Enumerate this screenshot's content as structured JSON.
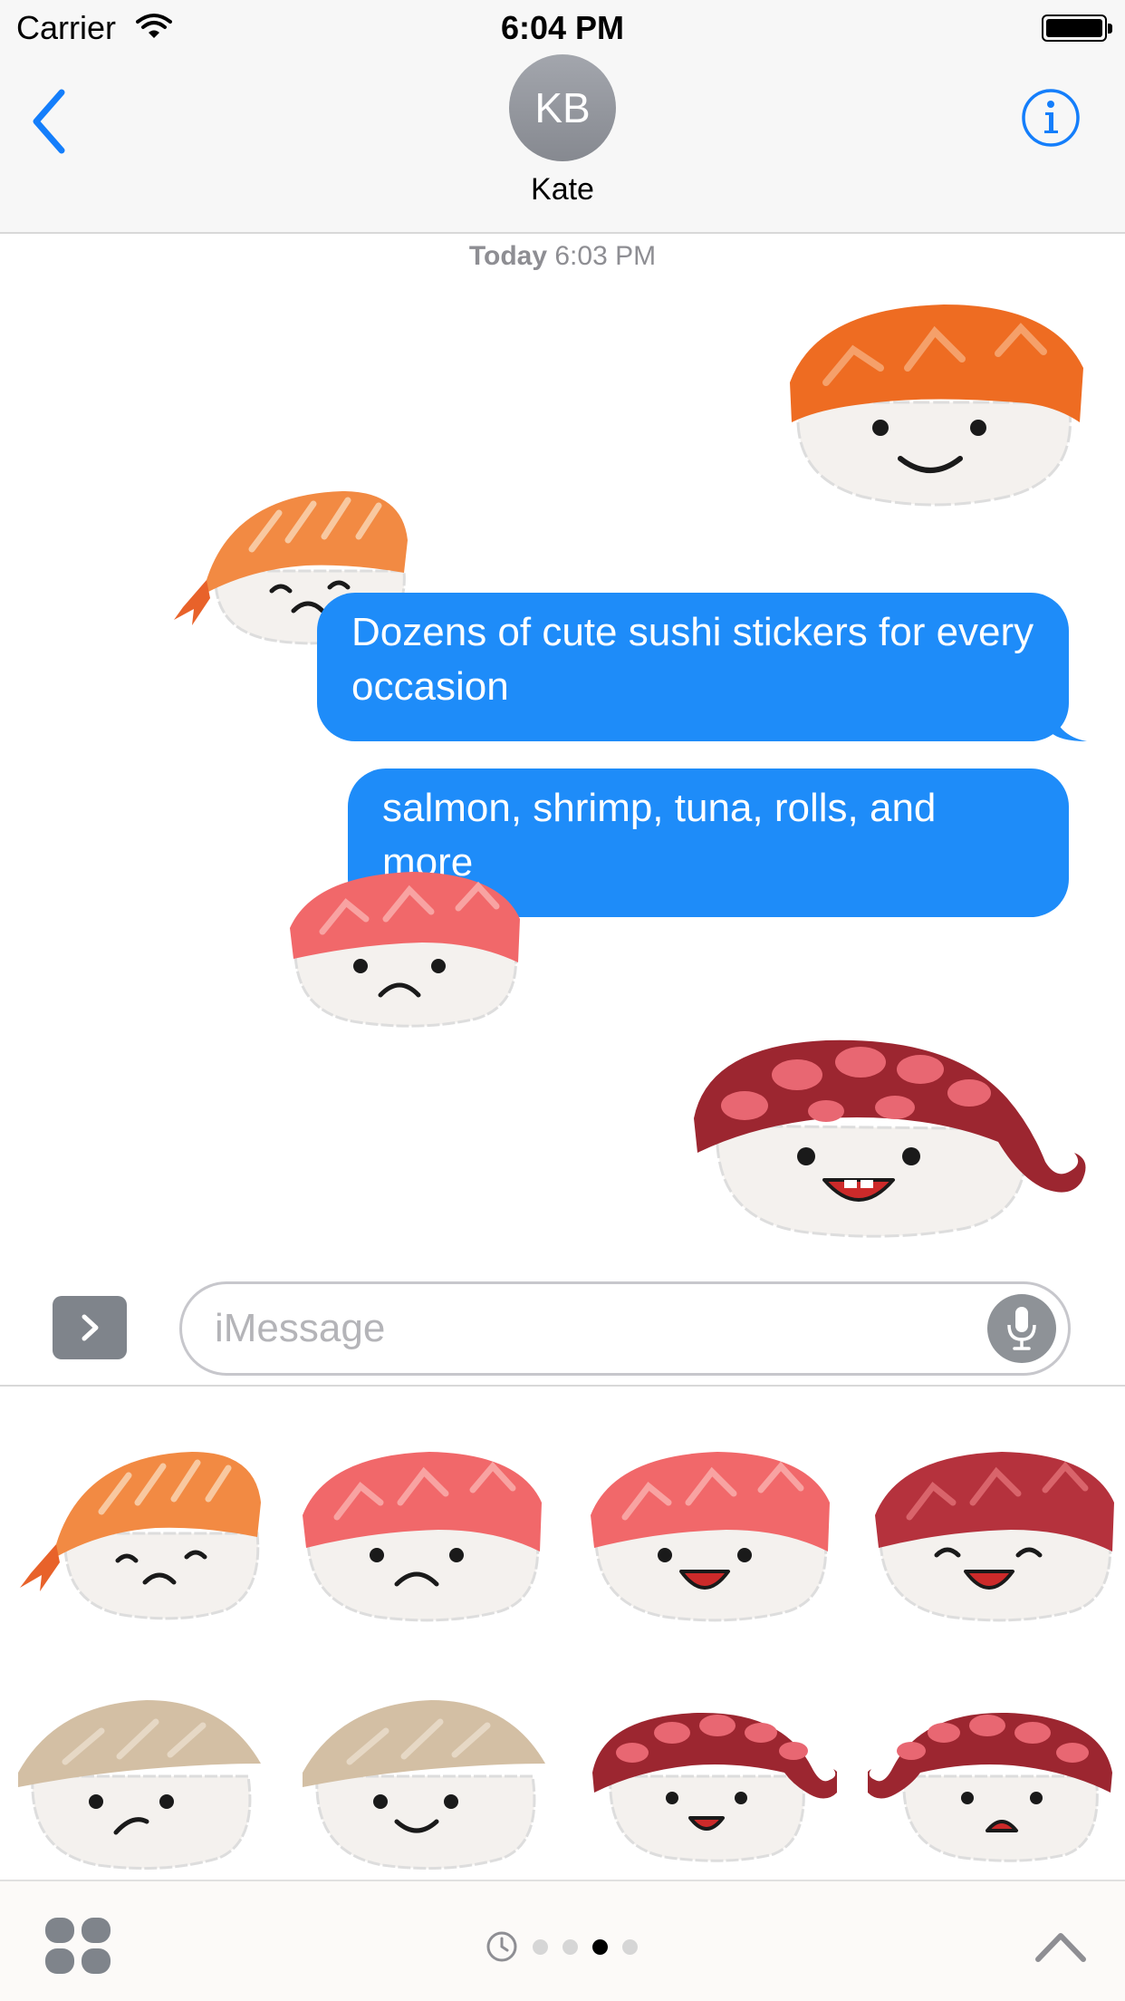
{
  "status_bar": {
    "carrier": "Carrier",
    "time": "6:04 PM"
  },
  "header": {
    "avatar_initials": "KB",
    "contact_name": "Kate",
    "back_icon": "chevron-left-icon",
    "info_icon": "info-icon"
  },
  "conversation": {
    "timestamp_day": "Today",
    "timestamp_time": "6:03 PM",
    "messages": [
      {
        "text": "Dozens of cute sushi stickers for every occasion",
        "sender": "me"
      },
      {
        "text": "salmon, shrimp, tuna, rolls, and more",
        "sender": "me"
      }
    ],
    "stickers": [
      "salmon-happy",
      "shrimp-sad",
      "tuna-sad",
      "octopus-happy"
    ]
  },
  "compose": {
    "placeholder": "iMessage",
    "apps_icon": "chevron-right-icon",
    "mic_icon": "microphone-icon"
  },
  "drawer": {
    "stickers": [
      "shrimp-grumpy",
      "tuna-sad",
      "tuna-laughing",
      "maguro-laughing",
      "hamachi-frown",
      "hamachi-smile",
      "octopus-smile",
      "octopus-worried"
    ],
    "page_count": 4,
    "active_page": 3
  },
  "colors": {
    "bubble_blue": "#1e8cf9",
    "ios_blue": "#147efb",
    "salmon": "#ee6c22",
    "shrimp": "#f28a43",
    "tuna": "#f1686a",
    "maguro": "#b5323d",
    "octopus": "#9c2630",
    "hamachi": "#d3bfa4"
  }
}
